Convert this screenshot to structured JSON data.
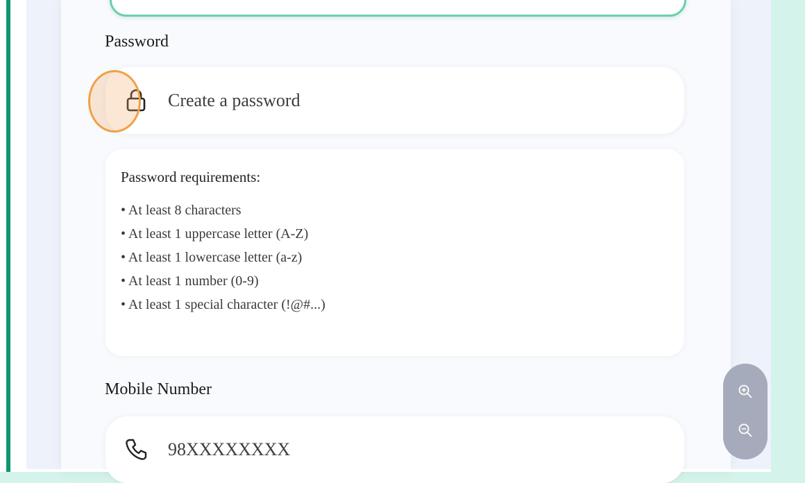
{
  "form": {
    "password_label": "Password",
    "password_placeholder": "Create a password",
    "requirements_title": "Password requirements:",
    "requirements": [
      "• At least 8 characters",
      "• At least 1 uppercase letter (A-Z)",
      "• At least 1 lowercase letter (a-z)",
      "• At least 1 number (0-9)",
      "• At least 1 special character (!@#...)"
    ],
    "mobile_label": "Mobile Number",
    "mobile_placeholder": "98XXXXXXXX"
  },
  "icons": {
    "password": "lock-icon",
    "mobile": "phone-icon",
    "zoom_in": "zoom-in-icon",
    "zoom_out": "zoom-out-icon"
  },
  "colors": {
    "accent": "#12956f",
    "page_background": "#d4f3ea",
    "focused_border": "#6ccfac",
    "click_highlight": "#f0a046",
    "zoom_control": "#a6abbb"
  }
}
